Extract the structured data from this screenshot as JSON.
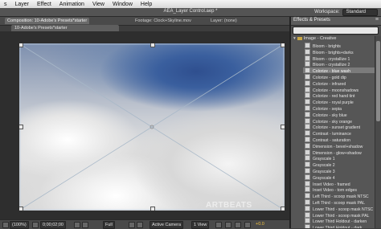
{
  "menu": [
    "s",
    "Layer",
    "Effect",
    "Animation",
    "View",
    "Window",
    "Help"
  ],
  "window": {
    "title": "AEA_Layer Control.aep *",
    "workspace_label": "Workspace:",
    "workspace_value": "Standard"
  },
  "viewer_tabs": {
    "composition": "Composition: 10-Adobe's Presets*starter",
    "footage": "Footage: Clock+Skyline.mov",
    "layer": "Layer: (none)",
    "sub_tab": "10-Adobe's Presets*starter"
  },
  "watermark": "ARTBEATS",
  "status": {
    "zoom": "(100%)",
    "timecode": "0;00;02;00",
    "resolution": "Full",
    "camera": "Active Camera",
    "views": "1 View",
    "exposure": "+0.0"
  },
  "effects_panel": {
    "title": "Effects & Presets",
    "category": "Image - Creative",
    "selected_index": 4,
    "items": [
      "Bloom - brights",
      "Bloom - brights+darks",
      "Bloom - crystallize 1",
      "Bloom - crystallize 2",
      "Colorize - blue wash",
      "Colorize - gold dip",
      "Colorize - infrared",
      "Colorize - moonshadows",
      "Colorize - red hand tint",
      "Colorize - royal purple",
      "Colorize - sepia",
      "Colorize - sky blue",
      "Colorize - sky orange",
      "Colorize - sunset gradient",
      "Contrast - luminance",
      "Contrast - saturation",
      "Dimension - bevel+shadow",
      "Dimension - glow+shadow",
      "Grayscale 1",
      "Grayscale 2",
      "Grayscale 3",
      "Grayscale 4",
      "Inset Video - framed",
      "Inset Video - torn edges",
      "Left Third - scoop mask NTSC",
      "Left Third - scoop mask PAL",
      "Lower Third - scoop mask NTSC",
      "Lower Third - scoop mask PAL",
      "Lower Third Holdout - darken",
      "Lower Third Holdout - dark"
    ]
  }
}
